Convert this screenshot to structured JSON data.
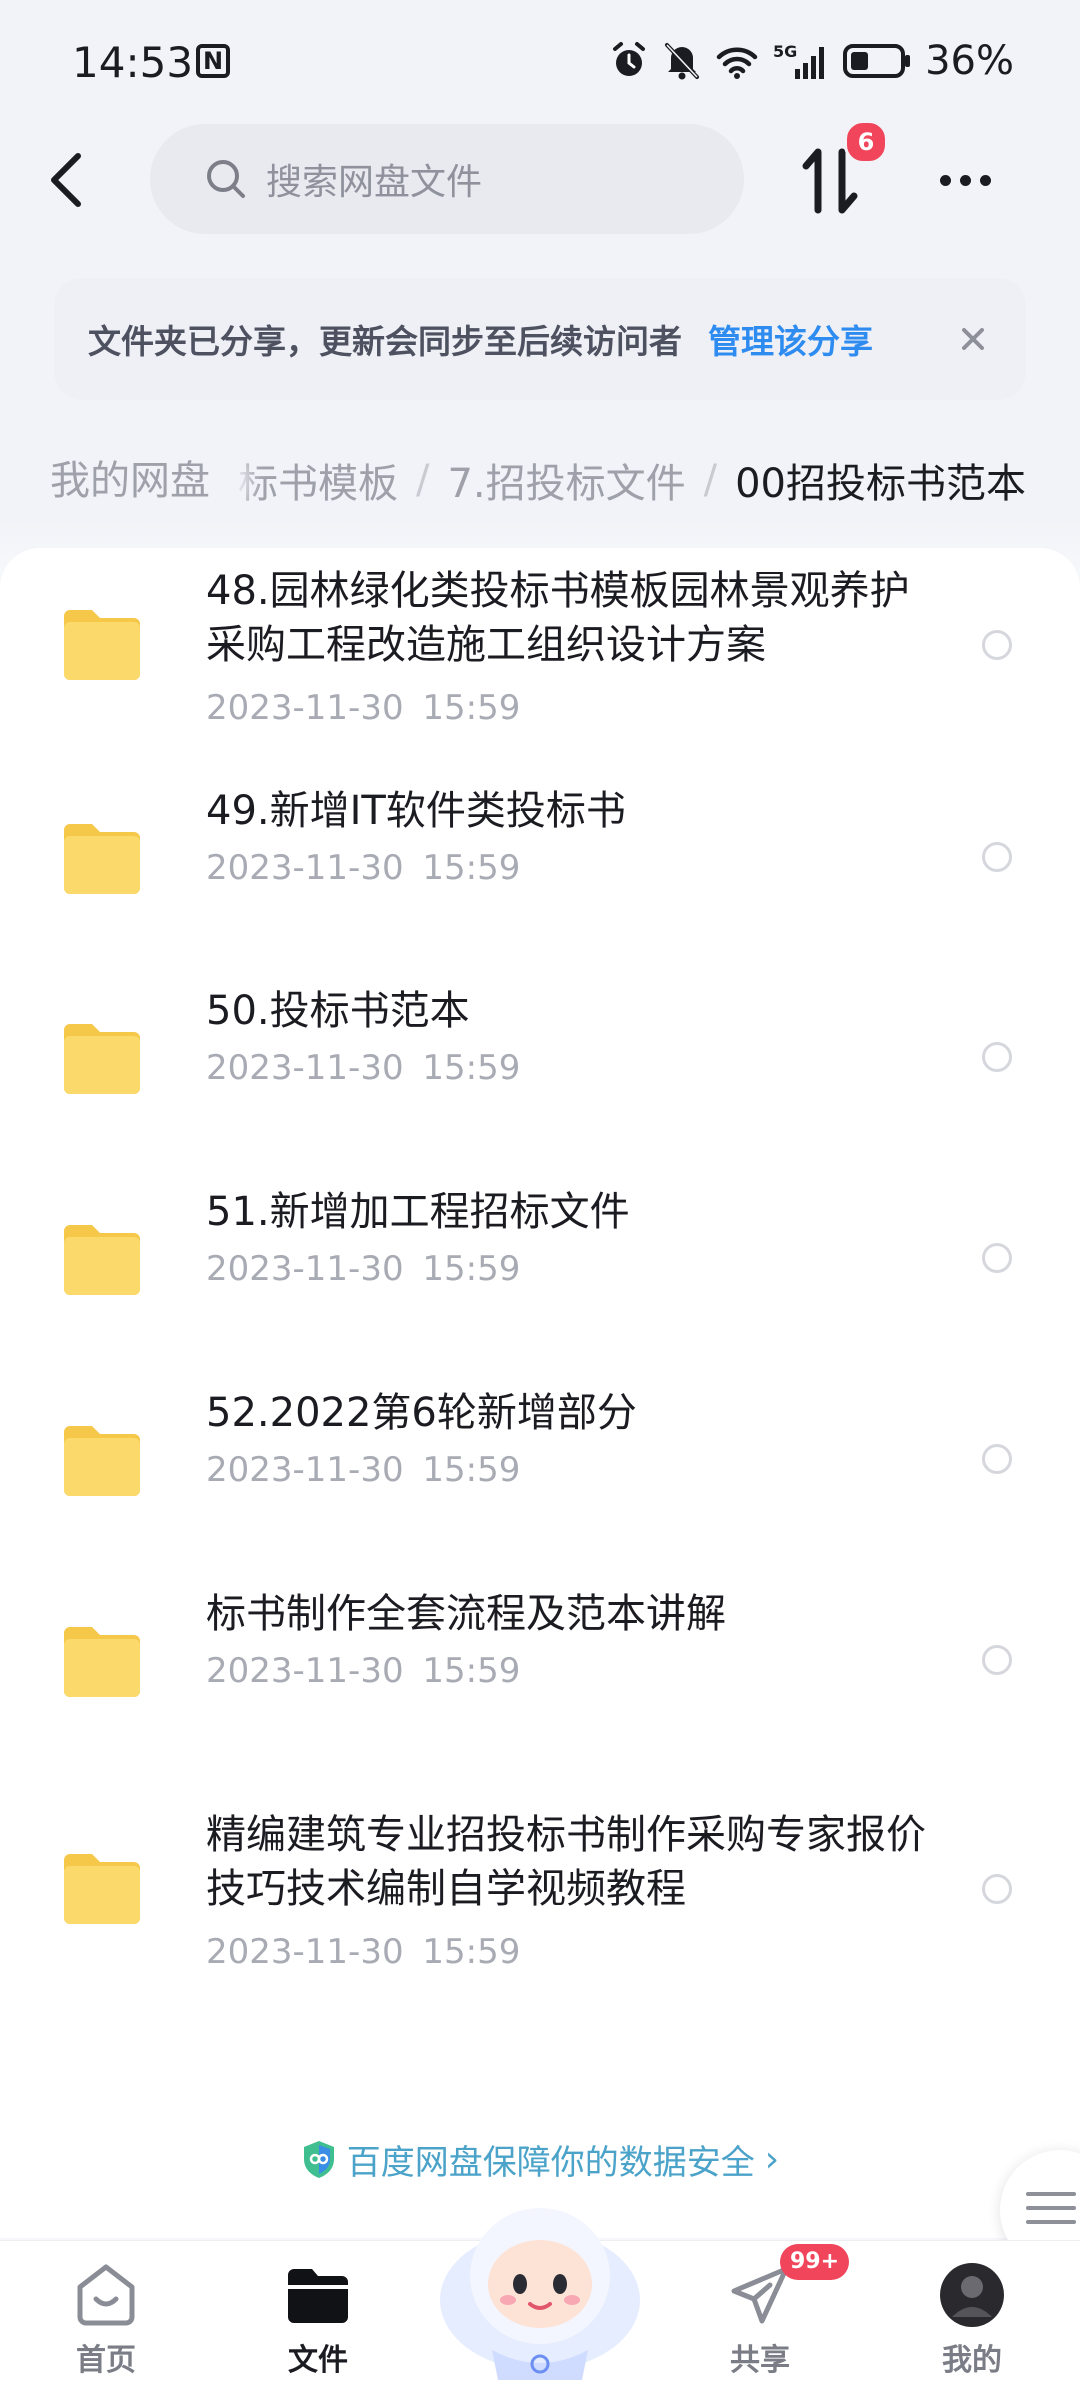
{
  "status_bar": {
    "time": "14:53",
    "nfc_label": "N",
    "network": "5G",
    "battery_percent": "36%",
    "battery_level": 0.36
  },
  "header": {
    "search_placeholder": "搜索网盘文件",
    "transfer_badge": "6"
  },
  "share_banner": {
    "text": "文件夹已分享，更新会同步至后续访问者",
    "action": "管理该分享"
  },
  "breadcrumb": {
    "root": "我的网盘",
    "items": [
      "标书模板",
      "7.招投标文件",
      "00招投标书范本"
    ],
    "separator": "/"
  },
  "files": [
    {
      "name": "48.园林绿化类投标书模板园林景观养护采购工程改造施工组织设计方案",
      "date": "2023-11-30  15:59"
    },
    {
      "name": "49.新增IT软件类投标书",
      "date": "2023-11-30  15:59"
    },
    {
      "name": "50.投标书范本",
      "date": "2023-11-30  15:59"
    },
    {
      "name": "51.新增加工程招标文件",
      "date": "2023-11-30  15:59"
    },
    {
      "name": "52.2022第6轮新增部分",
      "date": "2023-11-30  15:59"
    },
    {
      "name": "标书制作全套流程及范本讲解",
      "date": "2023-11-30  15:59"
    },
    {
      "name": "精编建筑专业招投标书制作采购专家报价技巧技术编制自学视频教程",
      "date": "2023-11-30  15:59"
    }
  ],
  "security_note": {
    "text": "百度网盘保障你的数据安全",
    "chevron": "›"
  },
  "bottom_nav": {
    "items": [
      {
        "label": "首页",
        "icon": "home-icon"
      },
      {
        "label": "文件",
        "icon": "folder-icon"
      },
      {
        "label": "共享",
        "icon": "send-icon"
      },
      {
        "label": "我的",
        "icon": "avatar"
      }
    ],
    "share_badge": "99+"
  },
  "colors": {
    "accent": "#2e8bf0",
    "badge": "#f0455b",
    "folder": "#f9d060",
    "security_text": "#4ba3c9"
  }
}
